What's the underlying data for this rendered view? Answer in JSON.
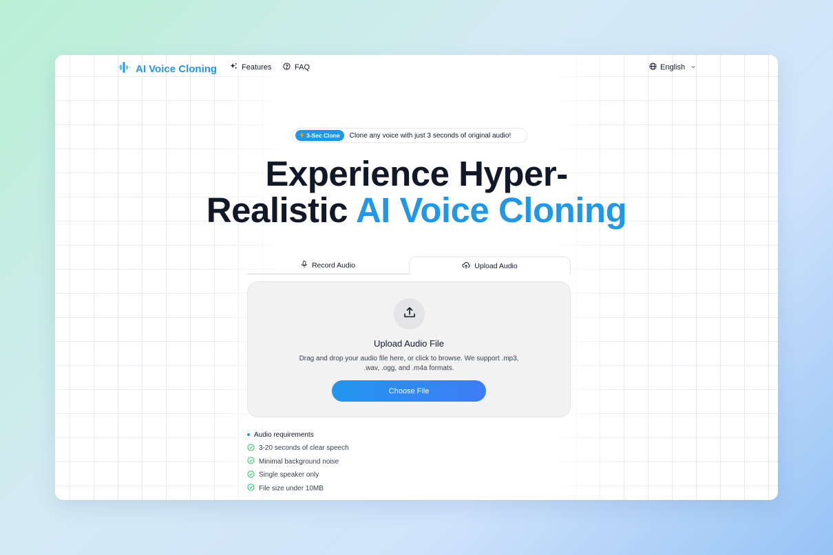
{
  "app": {
    "brand": "AI Voice Cloning",
    "accent_color": "#2197e6"
  },
  "nav": {
    "features": "Features",
    "faq": "FAQ",
    "language": "English"
  },
  "badge": {
    "pill": "3-Sec Clone",
    "text": "Clone any voice with just 3 seconds of original audio!"
  },
  "hero": {
    "line1": "Experience Hyper-",
    "line2_plain": "Realistic ",
    "line2_accent": "AI Voice Cloning"
  },
  "tabs": [
    {
      "label": "Record Audio",
      "icon": "microphone-icon",
      "active": false
    },
    {
      "label": "Upload Audio",
      "icon": "cloud-upload-icon",
      "active": true
    }
  ],
  "upload": {
    "title": "Upload Audio File",
    "description": "Drag and drop your audio file here, or click to browse. We support .mp3, .wav, .ogg, and .m4a formats.",
    "button": "Choose File"
  },
  "requirements": {
    "heading": "Audio requirements",
    "items": [
      "3-20 seconds of clear speech",
      "Minimal background noise",
      "Single speaker only",
      "File size under 10MB"
    ]
  }
}
